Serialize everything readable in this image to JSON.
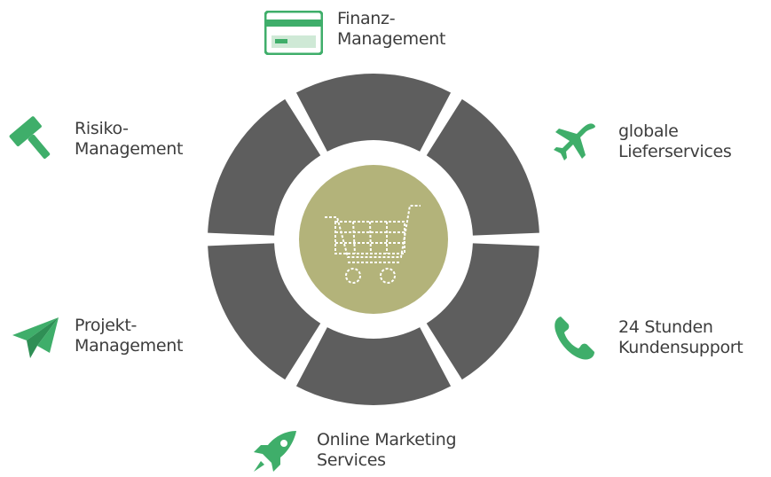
{
  "center_icon": "shopping-cart-icon",
  "colors": {
    "segment": "#5e5e5e",
    "center": "#b3b37a",
    "icon_green": "#3fae6a"
  },
  "services": [
    {
      "line1": "Finanz-",
      "line2": "Management",
      "icon": "credit-card-icon"
    },
    {
      "line1": "globale",
      "line2": "Lieferservices",
      "icon": "airplane-icon"
    },
    {
      "line1": "24 Stunden",
      "line2": "Kundensupport",
      "icon": "phone-icon"
    },
    {
      "line1": "Online Marketing",
      "line2": "Services",
      "icon": "rocket-icon"
    },
    {
      "line1": "Projekt-",
      "line2": "Management",
      "icon": "paper-plane-icon"
    },
    {
      "line1": "Risiko-",
      "line2": "Management",
      "icon": "hammer-icon"
    }
  ]
}
